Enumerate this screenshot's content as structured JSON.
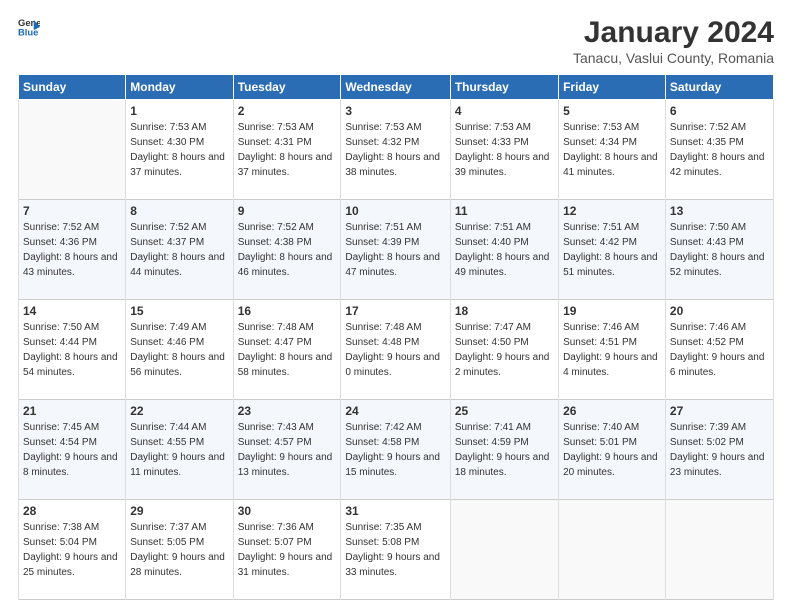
{
  "header": {
    "logo_line1": "General",
    "logo_line2": "Blue",
    "month": "January 2024",
    "location": "Tanacu, Vaslui County, Romania"
  },
  "days_of_week": [
    "Sunday",
    "Monday",
    "Tuesday",
    "Wednesday",
    "Thursday",
    "Friday",
    "Saturday"
  ],
  "weeks": [
    [
      {
        "day": "",
        "sunrise": "",
        "sunset": "",
        "daylight": ""
      },
      {
        "day": "1",
        "sunrise": "Sunrise: 7:53 AM",
        "sunset": "Sunset: 4:30 PM",
        "daylight": "Daylight: 8 hours and 37 minutes."
      },
      {
        "day": "2",
        "sunrise": "Sunrise: 7:53 AM",
        "sunset": "Sunset: 4:31 PM",
        "daylight": "Daylight: 8 hours and 37 minutes."
      },
      {
        "day": "3",
        "sunrise": "Sunrise: 7:53 AM",
        "sunset": "Sunset: 4:32 PM",
        "daylight": "Daylight: 8 hours and 38 minutes."
      },
      {
        "day": "4",
        "sunrise": "Sunrise: 7:53 AM",
        "sunset": "Sunset: 4:33 PM",
        "daylight": "Daylight: 8 hours and 39 minutes."
      },
      {
        "day": "5",
        "sunrise": "Sunrise: 7:53 AM",
        "sunset": "Sunset: 4:34 PM",
        "daylight": "Daylight: 8 hours and 41 minutes."
      },
      {
        "day": "6",
        "sunrise": "Sunrise: 7:52 AM",
        "sunset": "Sunset: 4:35 PM",
        "daylight": "Daylight: 8 hours and 42 minutes."
      }
    ],
    [
      {
        "day": "7",
        "sunrise": "Sunrise: 7:52 AM",
        "sunset": "Sunset: 4:36 PM",
        "daylight": "Daylight: 8 hours and 43 minutes."
      },
      {
        "day": "8",
        "sunrise": "Sunrise: 7:52 AM",
        "sunset": "Sunset: 4:37 PM",
        "daylight": "Daylight: 8 hours and 44 minutes."
      },
      {
        "day": "9",
        "sunrise": "Sunrise: 7:52 AM",
        "sunset": "Sunset: 4:38 PM",
        "daylight": "Daylight: 8 hours and 46 minutes."
      },
      {
        "day": "10",
        "sunrise": "Sunrise: 7:51 AM",
        "sunset": "Sunset: 4:39 PM",
        "daylight": "Daylight: 8 hours and 47 minutes."
      },
      {
        "day": "11",
        "sunrise": "Sunrise: 7:51 AM",
        "sunset": "Sunset: 4:40 PM",
        "daylight": "Daylight: 8 hours and 49 minutes."
      },
      {
        "day": "12",
        "sunrise": "Sunrise: 7:51 AM",
        "sunset": "Sunset: 4:42 PM",
        "daylight": "Daylight: 8 hours and 51 minutes."
      },
      {
        "day": "13",
        "sunrise": "Sunrise: 7:50 AM",
        "sunset": "Sunset: 4:43 PM",
        "daylight": "Daylight: 8 hours and 52 minutes."
      }
    ],
    [
      {
        "day": "14",
        "sunrise": "Sunrise: 7:50 AM",
        "sunset": "Sunset: 4:44 PM",
        "daylight": "Daylight: 8 hours and 54 minutes."
      },
      {
        "day": "15",
        "sunrise": "Sunrise: 7:49 AM",
        "sunset": "Sunset: 4:46 PM",
        "daylight": "Daylight: 8 hours and 56 minutes."
      },
      {
        "day": "16",
        "sunrise": "Sunrise: 7:48 AM",
        "sunset": "Sunset: 4:47 PM",
        "daylight": "Daylight: 8 hours and 58 minutes."
      },
      {
        "day": "17",
        "sunrise": "Sunrise: 7:48 AM",
        "sunset": "Sunset: 4:48 PM",
        "daylight": "Daylight: 9 hours and 0 minutes."
      },
      {
        "day": "18",
        "sunrise": "Sunrise: 7:47 AM",
        "sunset": "Sunset: 4:50 PM",
        "daylight": "Daylight: 9 hours and 2 minutes."
      },
      {
        "day": "19",
        "sunrise": "Sunrise: 7:46 AM",
        "sunset": "Sunset: 4:51 PM",
        "daylight": "Daylight: 9 hours and 4 minutes."
      },
      {
        "day": "20",
        "sunrise": "Sunrise: 7:46 AM",
        "sunset": "Sunset: 4:52 PM",
        "daylight": "Daylight: 9 hours and 6 minutes."
      }
    ],
    [
      {
        "day": "21",
        "sunrise": "Sunrise: 7:45 AM",
        "sunset": "Sunset: 4:54 PM",
        "daylight": "Daylight: 9 hours and 8 minutes."
      },
      {
        "day": "22",
        "sunrise": "Sunrise: 7:44 AM",
        "sunset": "Sunset: 4:55 PM",
        "daylight": "Daylight: 9 hours and 11 minutes."
      },
      {
        "day": "23",
        "sunrise": "Sunrise: 7:43 AM",
        "sunset": "Sunset: 4:57 PM",
        "daylight": "Daylight: 9 hours and 13 minutes."
      },
      {
        "day": "24",
        "sunrise": "Sunrise: 7:42 AM",
        "sunset": "Sunset: 4:58 PM",
        "daylight": "Daylight: 9 hours and 15 minutes."
      },
      {
        "day": "25",
        "sunrise": "Sunrise: 7:41 AM",
        "sunset": "Sunset: 4:59 PM",
        "daylight": "Daylight: 9 hours and 18 minutes."
      },
      {
        "day": "26",
        "sunrise": "Sunrise: 7:40 AM",
        "sunset": "Sunset: 5:01 PM",
        "daylight": "Daylight: 9 hours and 20 minutes."
      },
      {
        "day": "27",
        "sunrise": "Sunrise: 7:39 AM",
        "sunset": "Sunset: 5:02 PM",
        "daylight": "Daylight: 9 hours and 23 minutes."
      }
    ],
    [
      {
        "day": "28",
        "sunrise": "Sunrise: 7:38 AM",
        "sunset": "Sunset: 5:04 PM",
        "daylight": "Daylight: 9 hours and 25 minutes."
      },
      {
        "day": "29",
        "sunrise": "Sunrise: 7:37 AM",
        "sunset": "Sunset: 5:05 PM",
        "daylight": "Daylight: 9 hours and 28 minutes."
      },
      {
        "day": "30",
        "sunrise": "Sunrise: 7:36 AM",
        "sunset": "Sunset: 5:07 PM",
        "daylight": "Daylight: 9 hours and 31 minutes."
      },
      {
        "day": "31",
        "sunrise": "Sunrise: 7:35 AM",
        "sunset": "Sunset: 5:08 PM",
        "daylight": "Daylight: 9 hours and 33 minutes."
      },
      {
        "day": "",
        "sunrise": "",
        "sunset": "",
        "daylight": ""
      },
      {
        "day": "",
        "sunrise": "",
        "sunset": "",
        "daylight": ""
      },
      {
        "day": "",
        "sunrise": "",
        "sunset": "",
        "daylight": ""
      }
    ]
  ]
}
